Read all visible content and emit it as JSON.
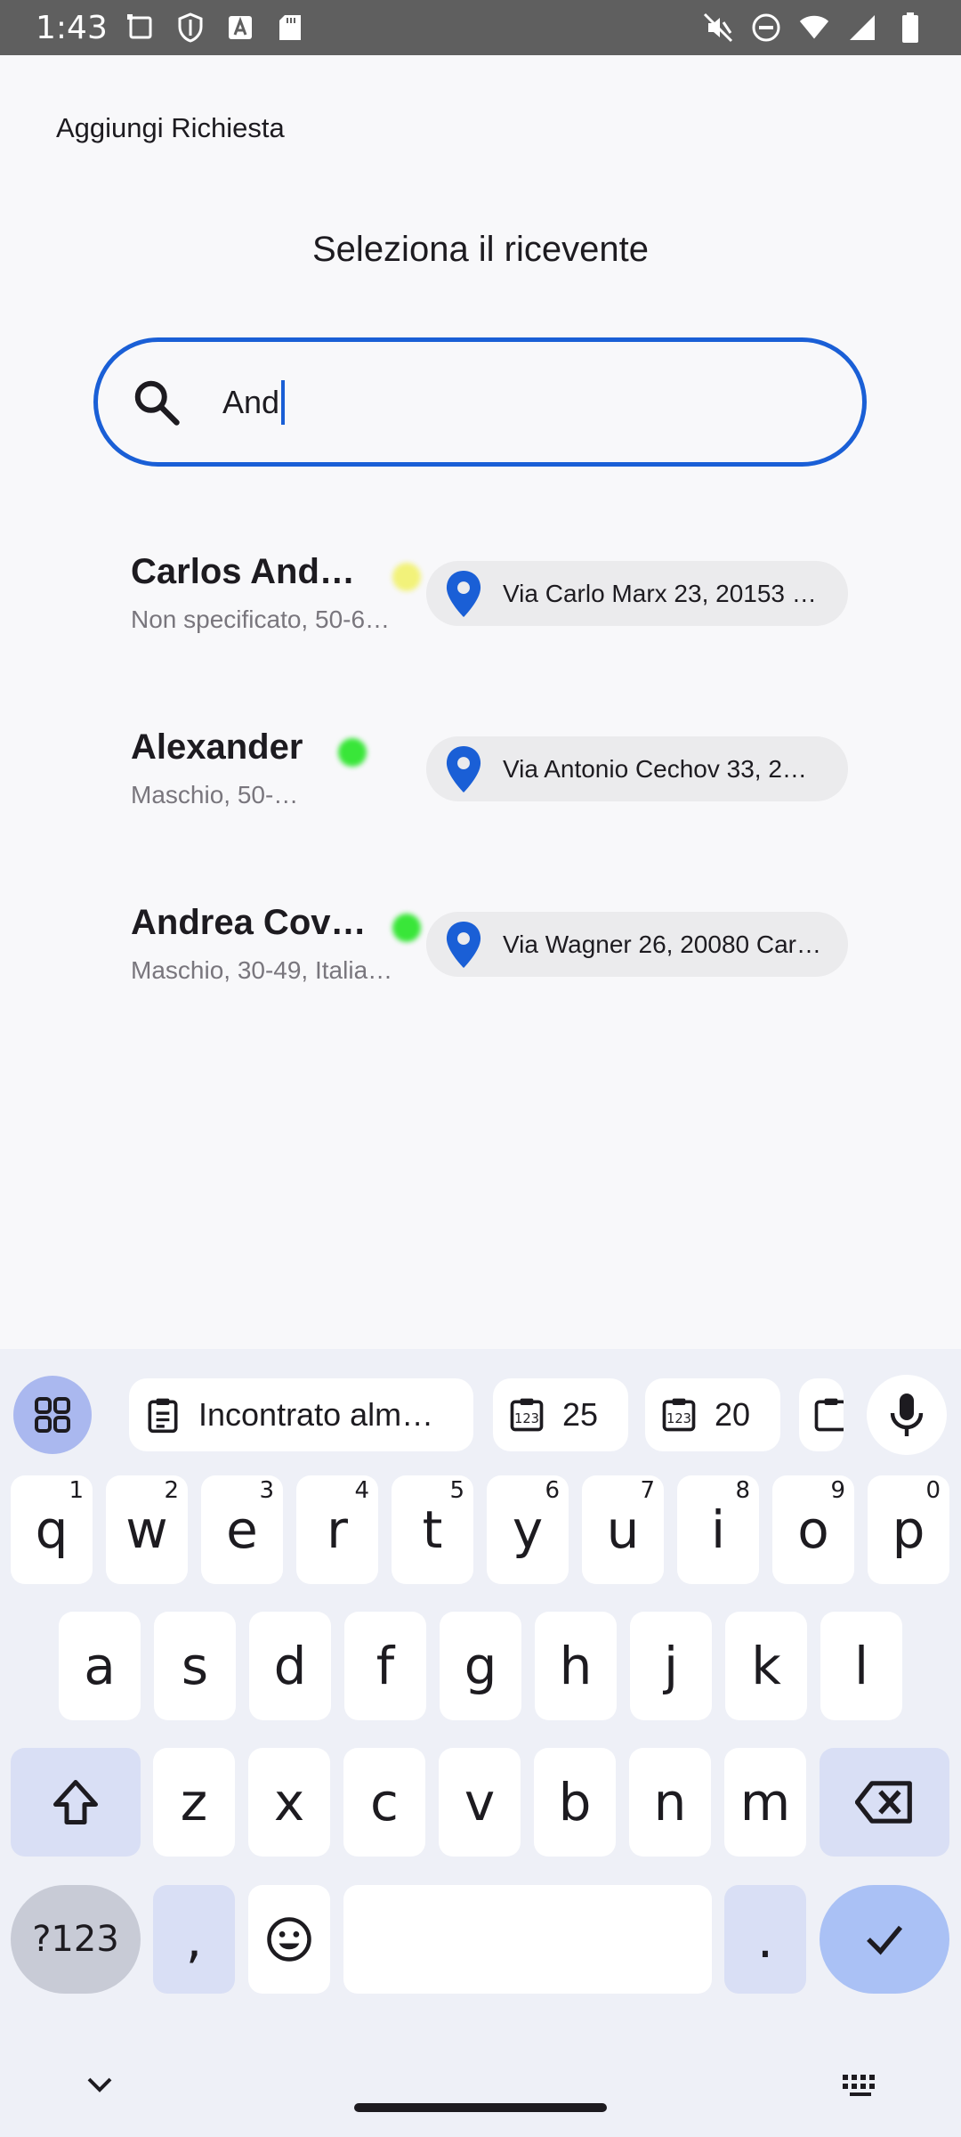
{
  "status_bar": {
    "time": "1:43"
  },
  "app": {
    "title": "Aggiungi Richiesta"
  },
  "page": {
    "section_title": "Seleziona il ricevente"
  },
  "search": {
    "value": "And"
  },
  "results": [
    {
      "name": "Carlos Ande…",
      "subtitle": "Non specificato, 50-6…",
      "status_color": "#f2f27a",
      "address": "Via Carlo Marx 23, 20153 …"
    },
    {
      "name": "Alexander",
      "subtitle": "Maschio, 50-…",
      "status_color": "#39e639",
      "address": "Via Antonio Cechov 33, 2…"
    },
    {
      "name": "Andrea Covi…",
      "subtitle": "Maschio, 30-49,  Italia…",
      "status_color": "#39e639",
      "address": "Via Wagner 26, 20080 Car…"
    }
  ],
  "keyboard": {
    "suggestions": [
      "Incontrato alm…",
      "25",
      "20"
    ],
    "row1": [
      {
        "k": "q",
        "h": "1"
      },
      {
        "k": "w",
        "h": "2"
      },
      {
        "k": "e",
        "h": "3"
      },
      {
        "k": "r",
        "h": "4"
      },
      {
        "k": "t",
        "h": "5"
      },
      {
        "k": "y",
        "h": "6"
      },
      {
        "k": "u",
        "h": "7"
      },
      {
        "k": "i",
        "h": "8"
      },
      {
        "k": "o",
        "h": "9"
      },
      {
        "k": "p",
        "h": "0"
      }
    ],
    "row2": [
      "a",
      "s",
      "d",
      "f",
      "g",
      "h",
      "j",
      "k",
      "l"
    ],
    "row3": [
      "z",
      "x",
      "c",
      "v",
      "b",
      "n",
      "m"
    ],
    "symbols_label": "?123",
    "comma": ",",
    "period": "."
  },
  "colors": {
    "accent": "#1a5fd6",
    "pin": "#1a5fd6"
  }
}
